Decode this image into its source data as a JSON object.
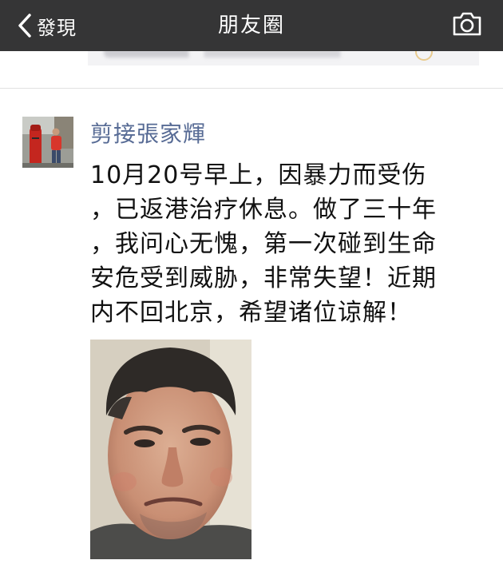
{
  "navbar": {
    "back_label": "發現",
    "title": "朋友圈",
    "back_icon": "chevron-left-icon",
    "camera_icon": "camera-icon"
  },
  "post": {
    "author": "剪接張家輝",
    "text_lines": [
      "10月20号早上，因暴力而受伤",
      "，已返港治疗休息。做了三十年",
      "，我问心无愧，第一次碰到生命",
      "安危受到威胁，非常失望！近期",
      "内不回北京，希望诸位谅解！"
    ]
  },
  "colors": {
    "navbar_bg": "#353536",
    "author_link": "#576b95",
    "body_text": "#111111"
  }
}
